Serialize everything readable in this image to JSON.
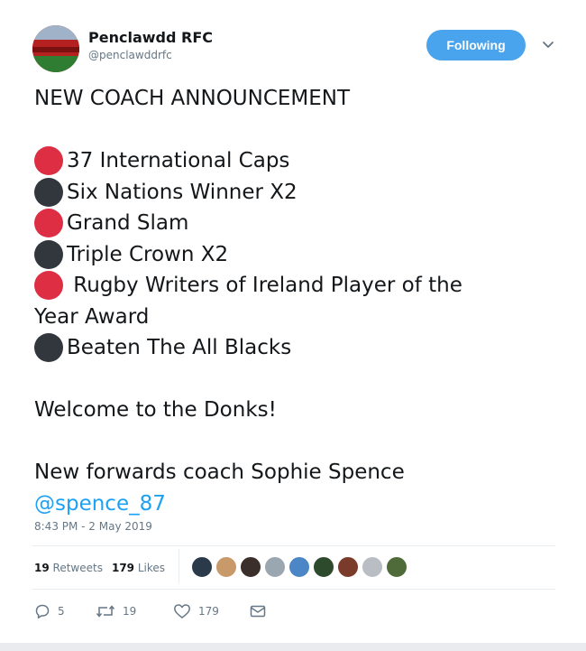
{
  "account": {
    "display_name": "Penclawdd RFC",
    "handle": "@penclawddrfc",
    "follow_label": "Following"
  },
  "tweet": {
    "title": "NEW COACH ANNOUNCEMENT",
    "achievements": [
      {
        "dot": "red",
        "text": "37 International Caps"
      },
      {
        "dot": "black",
        "text": "Six Nations Winner X2"
      },
      {
        "dot": "red",
        "text": "Grand Slam"
      },
      {
        "dot": "black",
        "text": "Triple Crown X2"
      },
      {
        "dot": "red",
        "text": " Rugby Writers of Ireland Player of the"
      },
      {
        "dot": "",
        "text": "Year Award"
      },
      {
        "dot": "black",
        "text": "Beaten The All Blacks"
      }
    ],
    "welcome": "Welcome to the Donks!",
    "closing": "New forwards coach Sophie Spence",
    "mention": "@spence_87",
    "timestamp": "8:43 PM - 2 May 2019"
  },
  "stats": {
    "retweets_count": "19",
    "retweets_label": "Retweets",
    "likes_count": "179",
    "likes_label": "Likes"
  },
  "likers": [
    {
      "color": "#2b3a4a"
    },
    {
      "color": "#c89a6a"
    },
    {
      "color": "#3a2f2a"
    },
    {
      "color": "#9aa6b0"
    },
    {
      "color": "#4c86c6"
    },
    {
      "color": "#2e4a2c"
    },
    {
      "color": "#7a3b2a"
    },
    {
      "color": "#b8bec4"
    },
    {
      "color": "#4f6b3a"
    }
  ],
  "actions": {
    "reply_count": "5",
    "retweet_count": "19",
    "like_count": "179"
  },
  "colors": {
    "red_dot": "#dd2e44",
    "black_dot": "#31373d",
    "follow_button": "#4aa3ed",
    "link": "#1da1f2"
  }
}
